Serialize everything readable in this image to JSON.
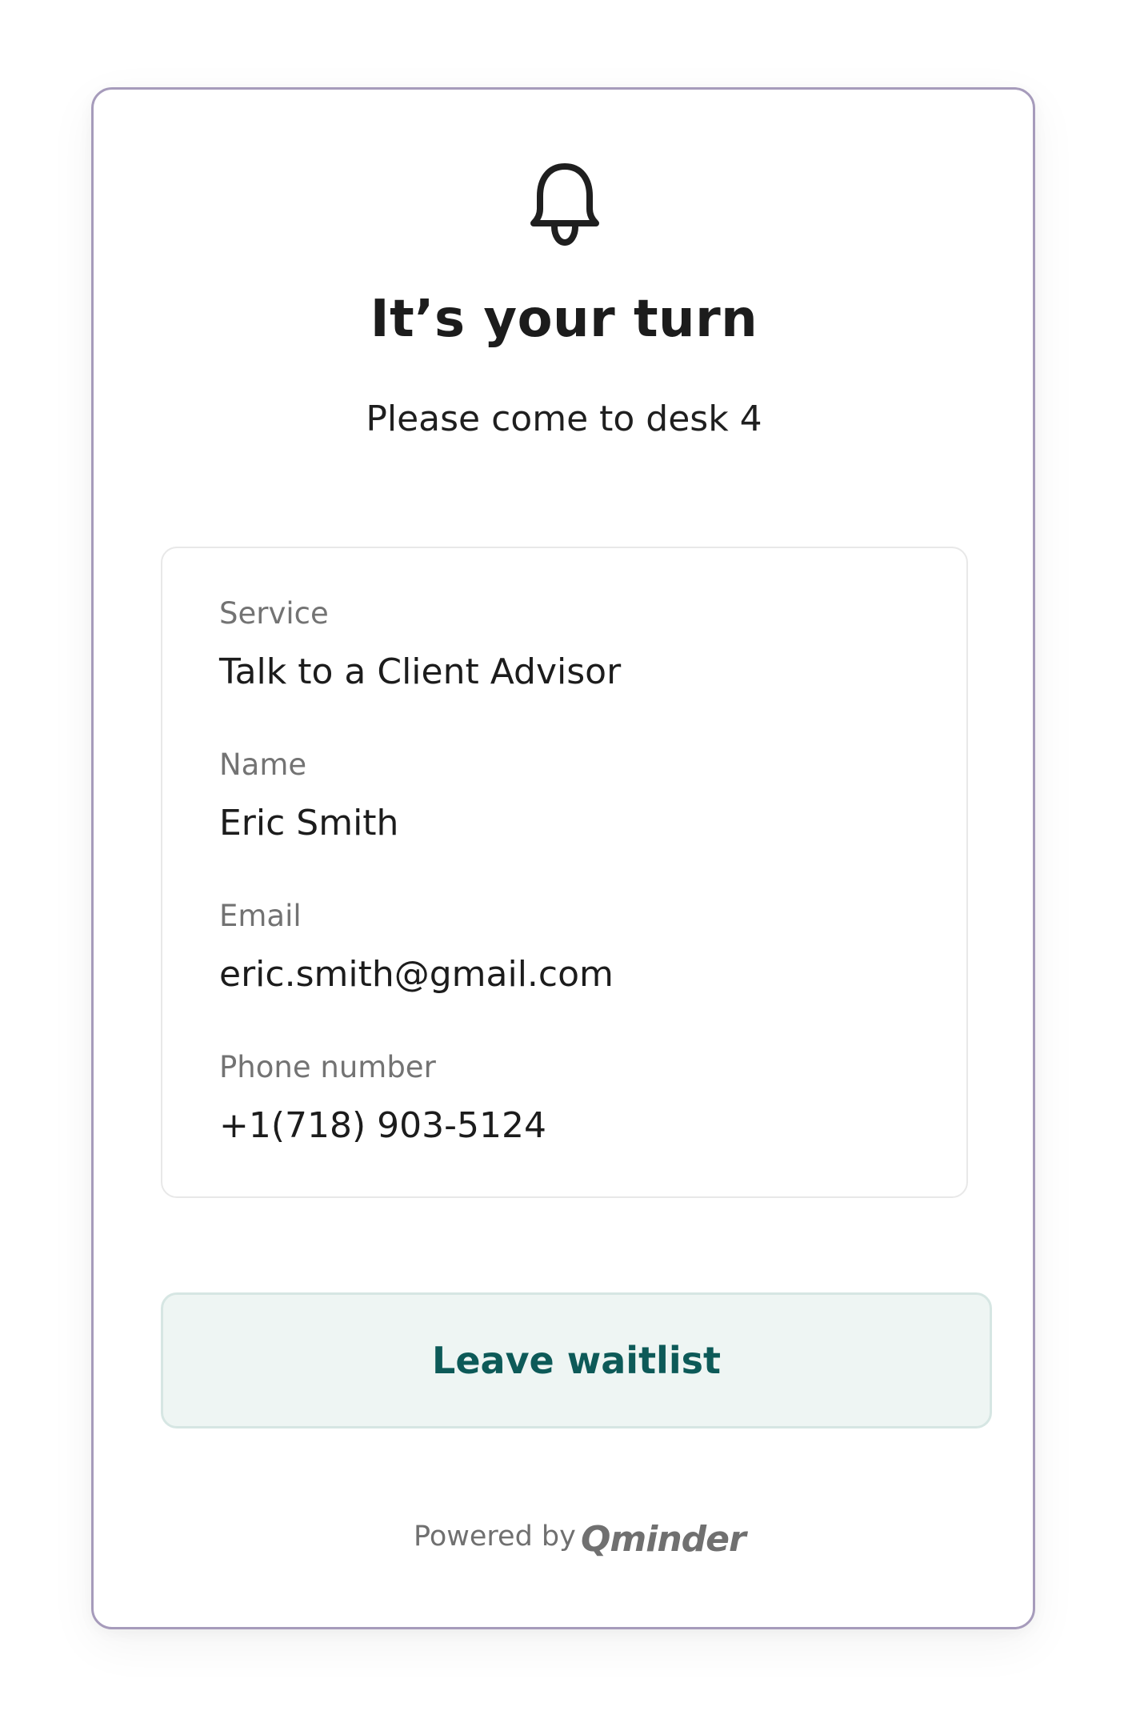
{
  "notification": {
    "icon": "bell-icon",
    "title": "It’s your turn",
    "subtitle": "Please come to desk 4"
  },
  "details": {
    "service_label": "Service",
    "service_value": "Talk to a Client Advisor",
    "name_label": "Name",
    "name_value": "Eric Smith",
    "email_label": "Email",
    "email_value": "eric.smith@gmail.com",
    "phone_label": "Phone number",
    "phone_value": "+1(718) 903-5124"
  },
  "actions": {
    "leave_label": "Leave waitlist"
  },
  "footer": {
    "powered_by": "Powered by",
    "brand": "Qminder"
  },
  "colors": {
    "card_border": "#a69bbb",
    "button_bg": "#eef5f3",
    "button_text": "#0d5a58",
    "label_gray": "#737373"
  }
}
